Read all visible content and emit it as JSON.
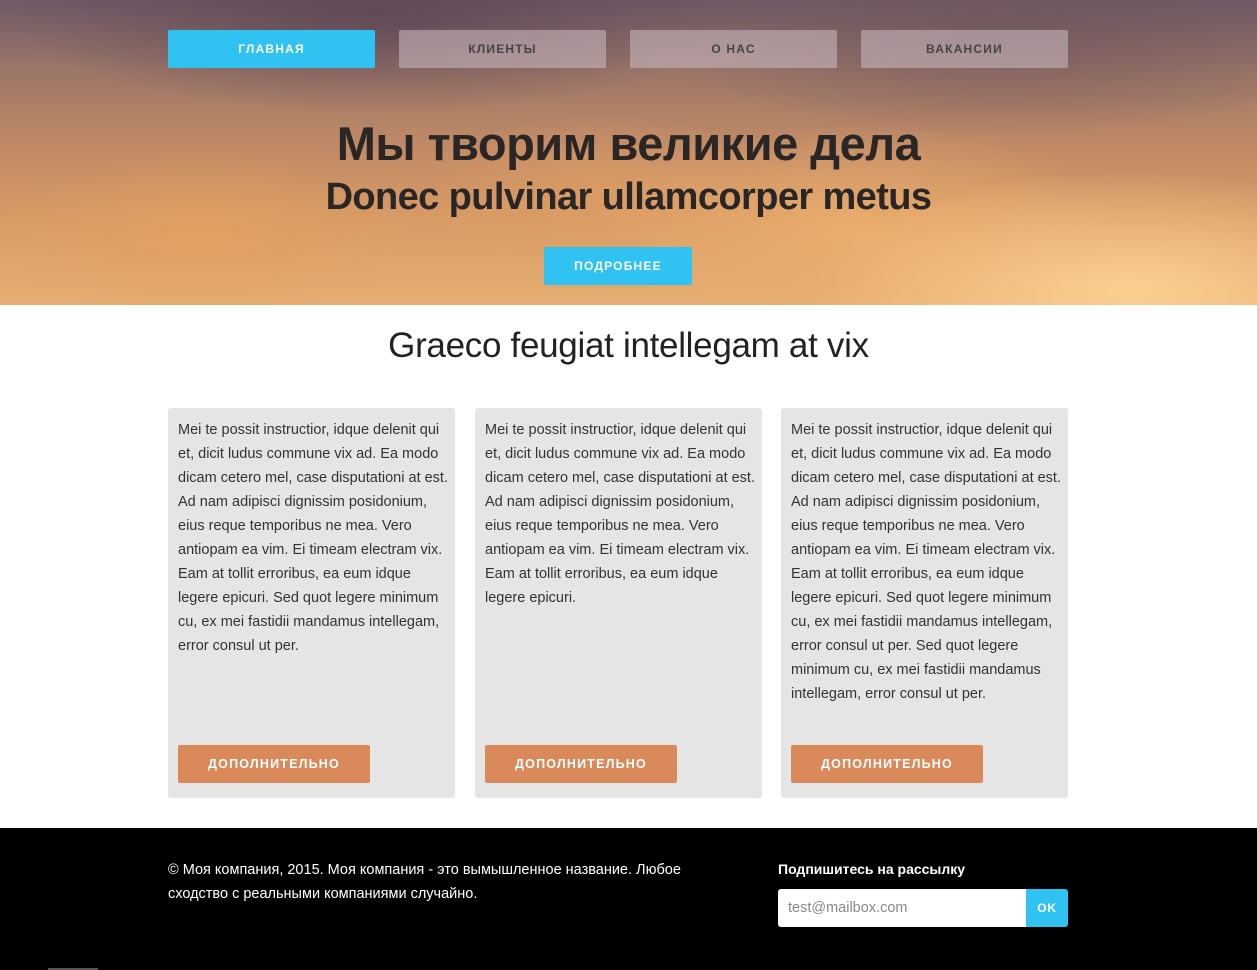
{
  "nav": {
    "items": [
      {
        "label": "ГЛАВНАЯ",
        "active": true
      },
      {
        "label": "КЛИЕНТЫ",
        "active": false
      },
      {
        "label": "О НАС",
        "active": false
      },
      {
        "label": "ВАКАНСИИ",
        "active": false
      }
    ]
  },
  "hero": {
    "title": "Мы творим великие дела",
    "subtitle": "Donec pulvinar ullamcorper metus",
    "cta_label": "ПОДРОБНЕЕ"
  },
  "section": {
    "heading": "Graeco feugiat intellegam at vix",
    "cards": [
      {
        "text": "Mei te possit instructior, idque delenit qui et, dicit ludus commune vix ad. Ea modo dicam cetero mel, case disputationi at est. Ad nam adipisci dignissim posidonium, eius reque temporibus ne mea. Vero antiopam ea vim. Ei timeam electram vix. Eam at tollit erroribus, ea eum idque legere epicuri. Sed quot legere minimum cu, ex mei fastidii mandamus intellegam, error consul ut per.",
        "button_label": "ДОПОЛНИТЕЛЬНО"
      },
      {
        "text": "Mei te possit instructior, idque delenit qui et, dicit ludus commune vix ad. Ea modo dicam cetero mel, case disputationi at est. Ad nam adipisci dignissim posidonium, eius reque temporibus ne mea. Vero antiopam ea vim. Ei timeam electram vix. Eam at tollit erroribus, ea eum idque legere epicuri.",
        "button_label": "ДОПОЛНИТЕЛЬНО"
      },
      {
        "text": "Mei te possit instructior, idque delenit qui et, dicit ludus commune vix ad. Ea modo dicam cetero mel, case disputationi at est. Ad nam adipisci dignissim posidonium, eius reque temporibus ne mea. Vero antiopam ea vim. Ei timeam electram vix. Eam at tollit erroribus, ea eum idque legere epicuri. Sed quot legere minimum cu, ex mei fastidii mandamus intellegam, error consul ut per. Sed quot legere minimum cu, ex mei fastidii mandamus intellegam, error consul ut per.",
        "button_label": "ДОПОЛНИТЕЛЬНО"
      }
    ]
  },
  "footer": {
    "copyright": "© Моя компания, 2015. Моя компания - это вымышленное название. Любое сходство с реальными компаниями случайно.",
    "newsletter": {
      "title": "Подпишитесь на рассылку",
      "placeholder": "test@mailbox.com",
      "button_label": "OK"
    }
  },
  "colors": {
    "accent_blue": "#30c2f0",
    "accent_orange": "#d9895a",
    "card_bg": "#e6e5e5",
    "footer_bg": "#000000"
  }
}
